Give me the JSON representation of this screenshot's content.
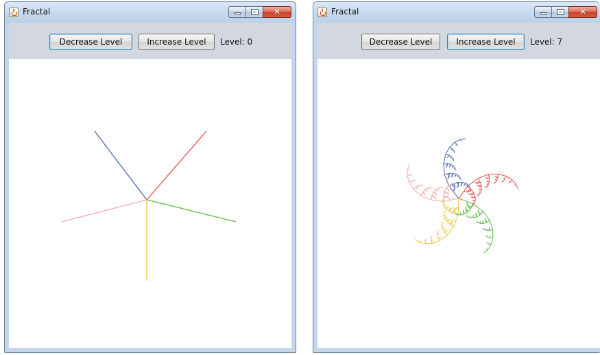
{
  "windows": [
    {
      "title": "Fractal",
      "buttons": {
        "decrease": "Decrease Level",
        "increase": "Increase Level"
      },
      "level_label": "Level: 0",
      "level": 0
    },
    {
      "title": "Fractal",
      "buttons": {
        "decrease": "Decrease Level",
        "increase": "Increase Level"
      },
      "level_label": "Level: 7",
      "level": 7
    }
  ],
  "colors": {
    "branch_1": "#4a64b4",
    "branch_2": "#ef4a4a",
    "branch_3": "#5cbd44",
    "branch_4": "#f2c23a",
    "branch_5": "#f4aaaa"
  },
  "icons": {
    "app": "java-cup-icon",
    "minimize": "minimize-icon",
    "maximize": "maximize-icon",
    "close": "close-icon"
  }
}
